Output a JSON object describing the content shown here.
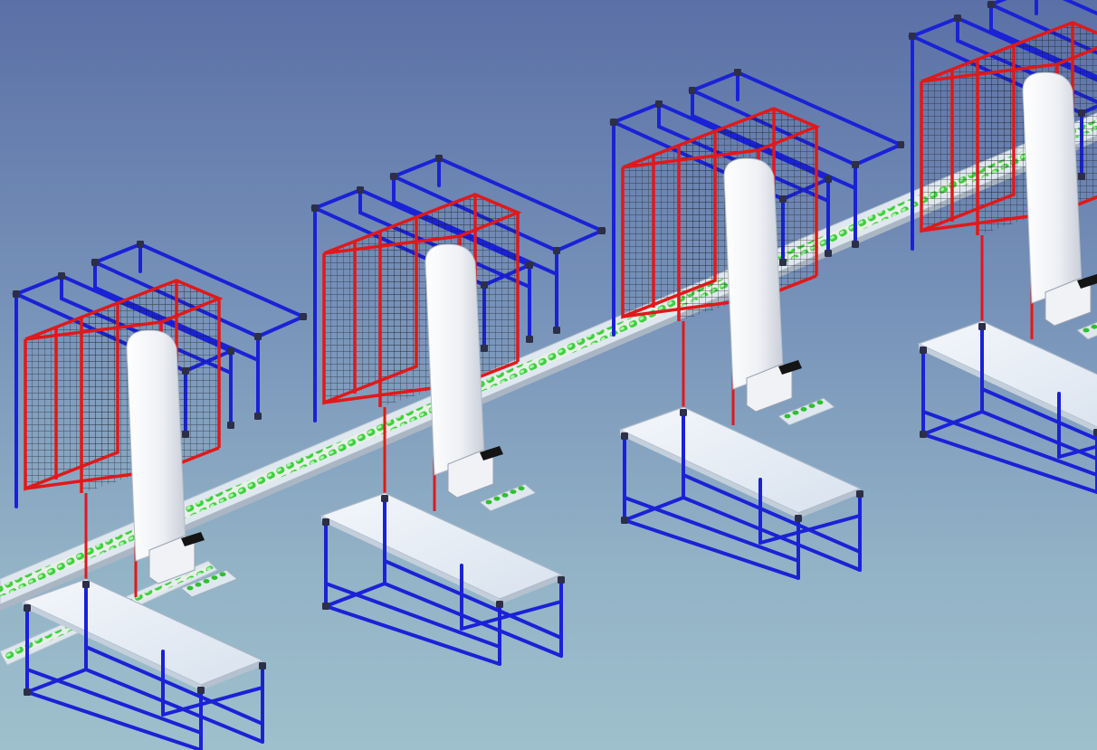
{
  "scene": {
    "stations": [
      {
        "id": "station-1"
      },
      {
        "id": "station-2"
      },
      {
        "id": "station-3"
      },
      {
        "id": "station-4"
      }
    ],
    "colors": {
      "background_top": "#5b70a6",
      "background_bottom": "#9ec0cc",
      "frame": "#1a22d6",
      "frame_joint": "#2c2f47",
      "cage": "#e0191a",
      "cage_mesh": "#1c1c22",
      "conveyor_roller": "#33c233",
      "conveyor_bed": "#e6edf5",
      "table_top": "#eef2f8",
      "column": "#f7f7fa"
    }
  }
}
